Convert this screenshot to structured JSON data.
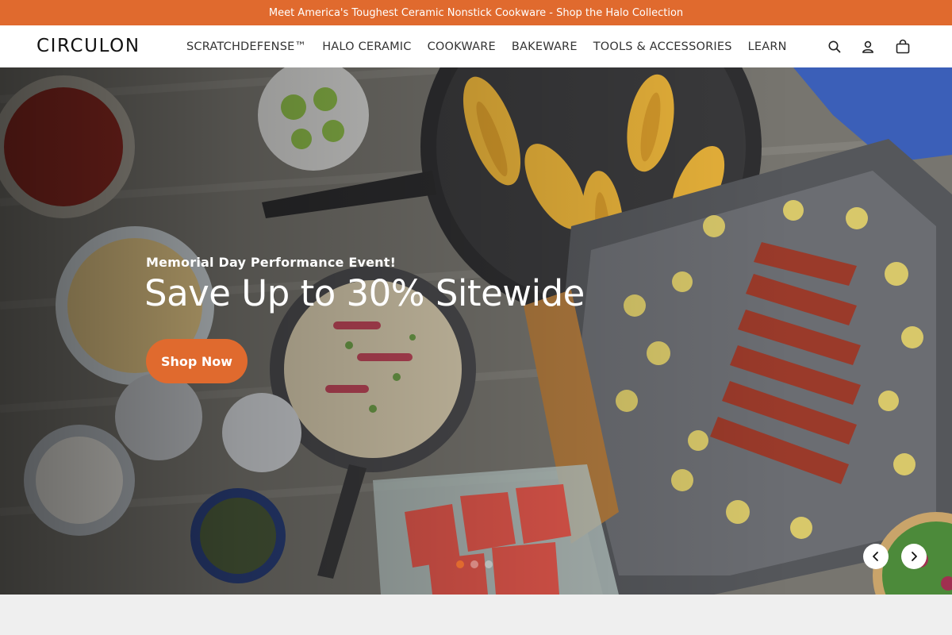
{
  "announcement": {
    "text": "Meet America's Toughest Ceramic Nonstick Cookware - Shop the Halo Collection"
  },
  "header": {
    "logo": "CIRCULON",
    "nav": [
      {
        "label": "SCRATCHDEFENSE™"
      },
      {
        "label": "HALO CERAMIC"
      },
      {
        "label": "COOKWARE"
      },
      {
        "label": "BAKEWARE"
      },
      {
        "label": "TOOLS & ACCESSORIES"
      },
      {
        "label": "LEARN"
      }
    ],
    "icons": [
      "search-icon",
      "account-icon",
      "cart-icon"
    ]
  },
  "hero": {
    "eyebrow": "Memorial Day Performance Event!",
    "headline": "Save Up to 30% Sitewide",
    "cta": "Shop Now",
    "slide_count": 3,
    "active_slide": 1
  },
  "colors": {
    "accent": "#e06a2e",
    "header_bg": "#ffffff",
    "text_dark": "#333333"
  }
}
